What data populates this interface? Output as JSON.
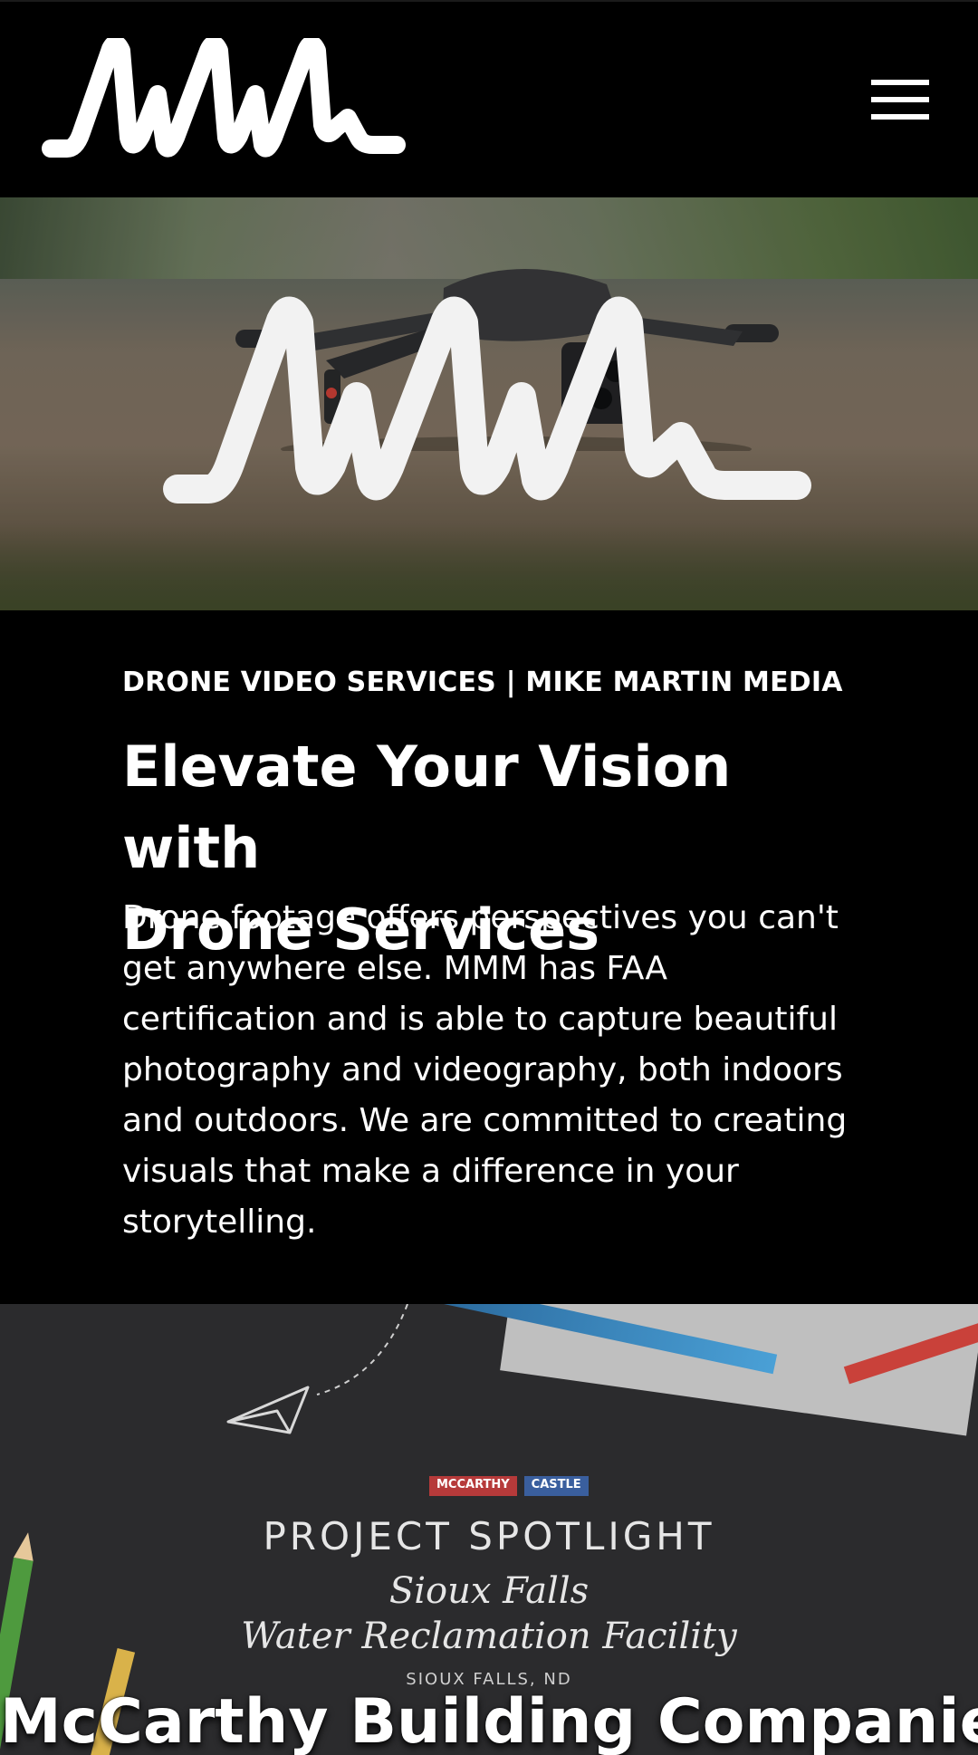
{
  "header": {
    "logo_alt": "MMM",
    "menu_label": "Menu"
  },
  "hero": {
    "image_subject": "drone",
    "logo_alt": "MMM"
  },
  "intro": {
    "eyebrow": "DRONE VIDEO SERVICES | MIKE MARTIN MEDIA",
    "headline_line1": "Elevate Your Vision with",
    "headline_line2": "Drone Services",
    "body": "Drone footage offers perspectives you can't get anywhere else. MMM has FAA certification and is able to capture beautiful photography and videography, both indoors and outdoors. We are committed to creating visuals that make a difference in your storytelling."
  },
  "spotlight": {
    "badge_1": "MCCARTHY",
    "badge_2": "CASTLE",
    "title": "PROJECT SPOTLIGHT",
    "subtitle_1": "Sioux Falls",
    "subtitle_2": "Water Reclamation Facility",
    "city": "SIOUX FALLS, ND",
    "client": "McCarthy Building Companies"
  },
  "colors": {
    "background": "#000000",
    "text": "#ffffff",
    "spotlight_bg": "#2b2b2d"
  },
  "icons": {
    "menu": "hamburger-icon"
  }
}
